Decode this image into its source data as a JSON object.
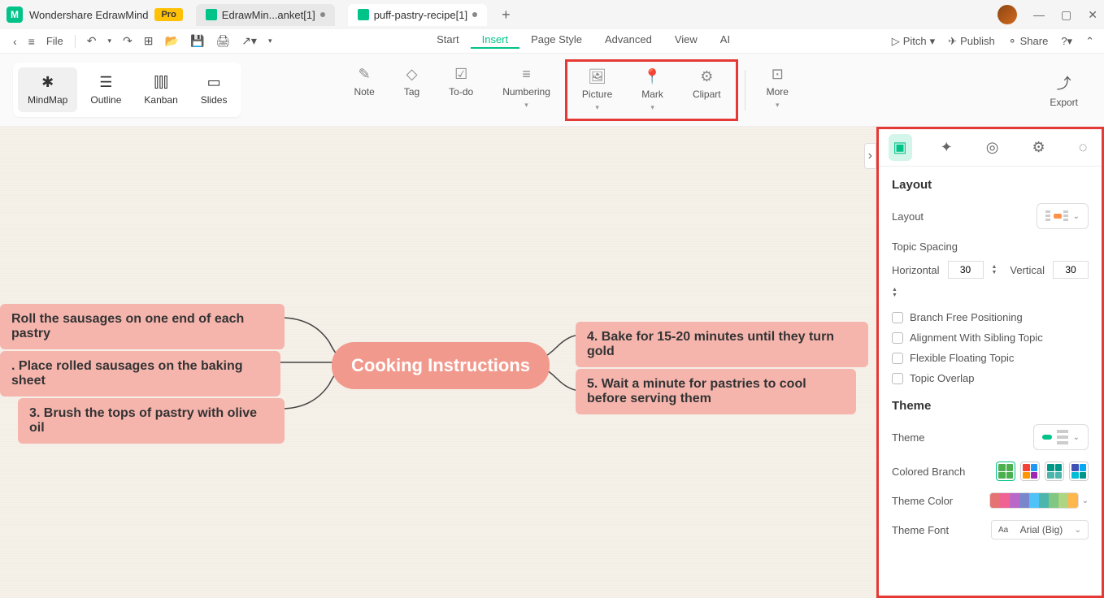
{
  "app": {
    "name": "Wondershare EdrawMind",
    "badge": "Pro"
  },
  "tabs": [
    {
      "label": "EdrawMin...anket[1]",
      "modified": true
    },
    {
      "label": "puff-pastry-recipe[1]",
      "modified": true,
      "active": true
    }
  ],
  "menubar": {
    "file": "File",
    "items": [
      "Start",
      "Insert",
      "Page Style",
      "Advanced",
      "View",
      "AI"
    ],
    "active": "Insert",
    "right": {
      "pitch": "Pitch",
      "publish": "Publish",
      "share": "Share"
    }
  },
  "views": [
    {
      "label": "MindMap",
      "active": true
    },
    {
      "label": "Outline"
    },
    {
      "label": "Kanban"
    },
    {
      "label": "Slides"
    }
  ],
  "tools": [
    {
      "label": "Note"
    },
    {
      "label": "Tag"
    },
    {
      "label": "To-do"
    },
    {
      "label": "Numbering",
      "dropdown": true
    },
    {
      "label": "Picture",
      "dropdown": true
    },
    {
      "label": "Mark",
      "dropdown": true
    },
    {
      "label": "Clipart"
    },
    {
      "label": "More",
      "dropdown": true
    }
  ],
  "export": "Export",
  "mindmap": {
    "center": "Cooking Instructions",
    "left": [
      "Roll the sausages on one end of each pastry",
      ". Place rolled sausages on the baking sheet",
      "3. Brush the tops of pastry with olive oil"
    ],
    "right": [
      "4. Bake for 15-20 minutes until they turn gold",
      "5. Wait a minute for pastries to cool before serving them"
    ]
  },
  "panel": {
    "layout": {
      "title": "Layout",
      "layout_label": "Layout",
      "spacing_label": "Topic Spacing",
      "horizontal_label": "Horizontal",
      "horizontal": "30",
      "vertical_label": "Vertical",
      "vertical": "30",
      "checks": [
        "Branch Free Positioning",
        "Alignment With Sibling Topic",
        "Flexible Floating Topic",
        "Topic Overlap"
      ]
    },
    "theme": {
      "title": "Theme",
      "theme_label": "Theme",
      "branch_label": "Colored Branch",
      "color_label": "Theme Color",
      "font_label": "Theme Font",
      "font_value": "Arial (Big)",
      "colors": [
        "#e57373",
        "#f06292",
        "#ba68c8",
        "#7986cb",
        "#4fc3f7",
        "#4db6ac",
        "#81c784",
        "#aed581",
        "#ffb74d"
      ]
    }
  }
}
